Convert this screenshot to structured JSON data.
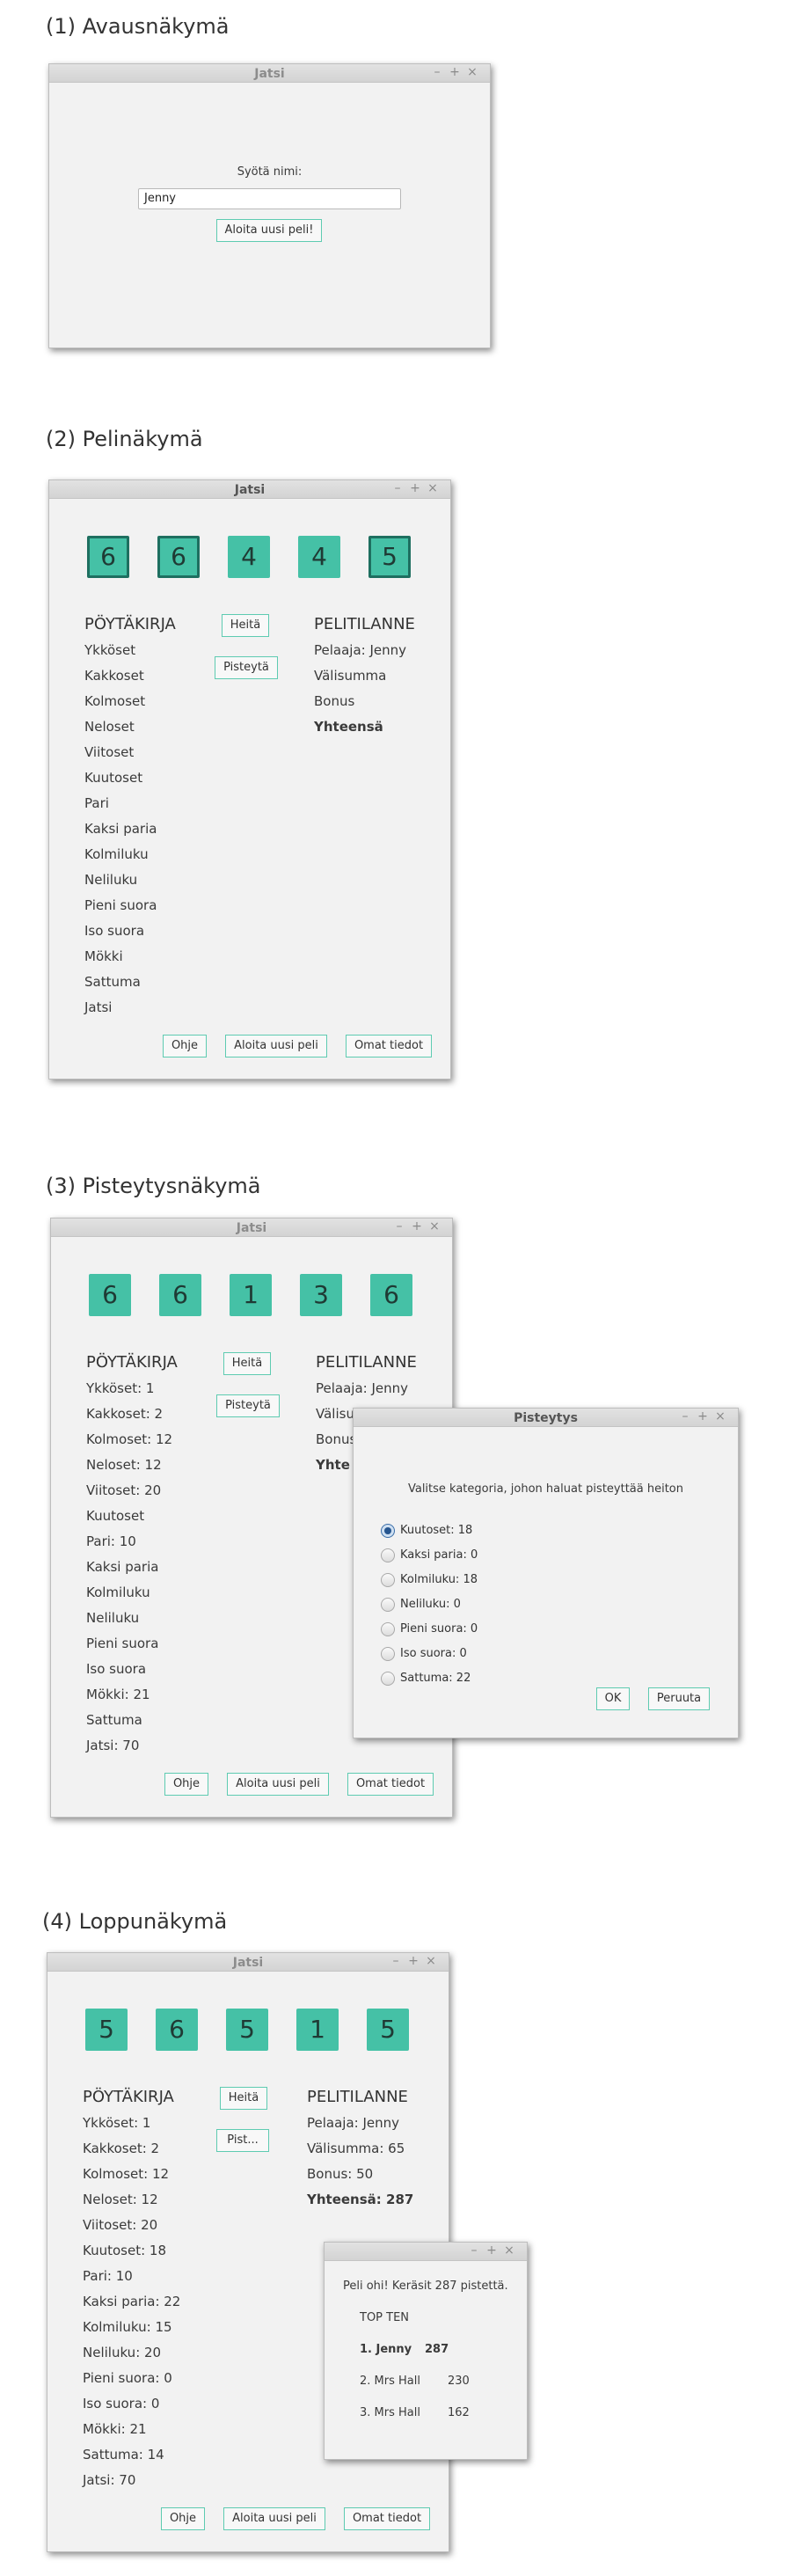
{
  "s1": {
    "heading": "(1) Avausnäkymä",
    "window_title": "Jatsi",
    "controls": [
      "–",
      "+",
      "×"
    ],
    "prompt": "Syötä nimi:",
    "name_value": "Jenny",
    "start_button": "Aloita uusi peli!"
  },
  "s2": {
    "heading": "(2) Pelinäkymä",
    "window_title": "Jatsi",
    "dice": [
      "6",
      "6",
      "4",
      "4",
      "5"
    ],
    "dice_held": [
      true,
      true,
      false,
      false,
      true
    ],
    "scoresheet_title": "PÖYTÄKIRJA",
    "categories": [
      "Ykköset",
      "Kakkoset",
      "Kolmoset",
      "Neloset",
      "Viitoset",
      "Kuutoset",
      "Pari",
      "Kaksi paria",
      "Kolmiluku",
      "Neliluku",
      "Pieni suora",
      "Iso suora",
      "Mökki",
      "Sattuma",
      "Jatsi"
    ],
    "roll_button": "Heitä",
    "score_button": "Pisteytä",
    "status_title": "PELITILANNE",
    "status": [
      "Pelaaja: Jenny",
      "Välisumma",
      "Bonus",
      "Yhteensä"
    ],
    "bottom_buttons": [
      "Ohje",
      "Aloita uusi peli",
      "Omat tiedot"
    ]
  },
  "s3": {
    "heading": "(3) Pisteytysnäkymä",
    "window_title": "Jatsi",
    "dice": [
      "6",
      "6",
      "1",
      "3",
      "6"
    ],
    "scoresheet_title": "PÖYTÄKIRJA",
    "categories": [
      "Ykköset: 1",
      "Kakkoset: 2",
      "Kolmoset: 12",
      "Neloset: 12",
      "Viitoset: 20",
      "Kuutoset",
      "Pari: 10",
      "Kaksi paria",
      "Kolmiluku",
      "Neliluku",
      "Pieni suora",
      "Iso suora",
      "Mökki: 21",
      "Sattuma",
      "Jatsi: 70"
    ],
    "roll_button": "Heitä",
    "score_button": "Pisteytä",
    "status_title": "PELITILANNE",
    "status": [
      "Pelaaja: Jenny",
      "Välisu",
      "Bonus",
      "Yhte"
    ],
    "bottom_buttons": [
      "Ohje",
      "Aloita uusi peli",
      "Omat tiedot"
    ],
    "dialog": {
      "title": "Pisteytys",
      "prompt": "Valitse kategoria, johon haluat pisteyttää heiton",
      "options": [
        "Kuutoset: 18",
        "Kaksi paria: 0",
        "Kolmiluku: 18",
        "Neliluku: 0",
        "Pieni suora: 0",
        "Iso suora: 0",
        "Sattuma: 22"
      ],
      "selected_index": 0,
      "ok": "OK",
      "cancel": "Peruuta"
    }
  },
  "s4": {
    "heading": "(4) Loppunäkymä",
    "window_title": "Jatsi",
    "dice": [
      "5",
      "6",
      "5",
      "1",
      "5"
    ],
    "scoresheet_title": "PÖYTÄKIRJA",
    "categories": [
      "Ykköset: 1",
      "Kakkoset: 2",
      "Kolmoset: 12",
      "Neloset: 12",
      "Viitoset: 20",
      "Kuutoset: 18",
      "Pari: 10",
      "Kaksi paria: 22",
      "Kolmiluku: 15",
      "Neliluku: 20",
      "Pieni suora: 0",
      "Iso suora: 0",
      "Mökki: 21",
      "Sattuma: 14",
      "Jatsi: 70"
    ],
    "roll_button": "Heitä",
    "score_button": "Pist...",
    "status_title": "PELITILANNE",
    "status": [
      "Pelaaja: Jenny",
      "Välisumma: 65",
      "Bonus: 50",
      "Yhteensä: 287"
    ],
    "bottom_buttons": [
      "Ohje",
      "Aloita uusi peli",
      "Omat tiedot"
    ],
    "dialog": {
      "message": "Peli ohi! Keräsit 287 pistettä.",
      "top_title": "TOP TEN",
      "top": [
        {
          "rank": "1. Jenny",
          "score": "287"
        },
        {
          "rank": "2. Mrs Hall",
          "score": "230"
        },
        {
          "rank": "3. Mrs Hall",
          "score": "162"
        }
      ]
    }
  },
  "colors": {
    "die": "#45c1a6",
    "held_border": "#1e6f60",
    "button_border": "#5ecbb1"
  }
}
